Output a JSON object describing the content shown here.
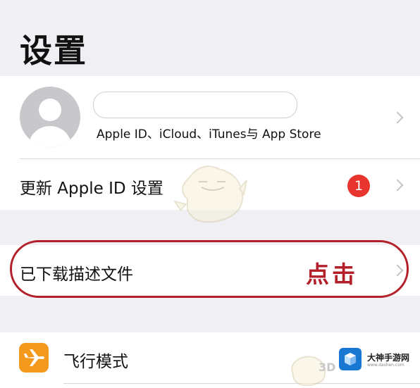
{
  "header": {
    "title": "设置"
  },
  "profile": {
    "name_value": "",
    "subtitle": "Apple ID、iCloud、iTunes与 App Store"
  },
  "update_row": {
    "label": "更新 Apple ID 设置",
    "badge": "1"
  },
  "profiles_row": {
    "label": "已下载描述文件",
    "annotation": "点击"
  },
  "airplane_row": {
    "label": "飞行模式"
  },
  "watermark": {
    "brand": "大神手游网",
    "url": "www.dashen.com",
    "tag": "3D"
  },
  "colors": {
    "annotation": "#b3202a",
    "badge": "#e8352d",
    "airplane_icon": "#f39a1d",
    "watermark_logo": "#1877d1"
  },
  "icons": [
    "avatar-icon",
    "chevron-right-icon",
    "airplane-icon",
    "mascot-icon",
    "watermark-logo-icon"
  ]
}
